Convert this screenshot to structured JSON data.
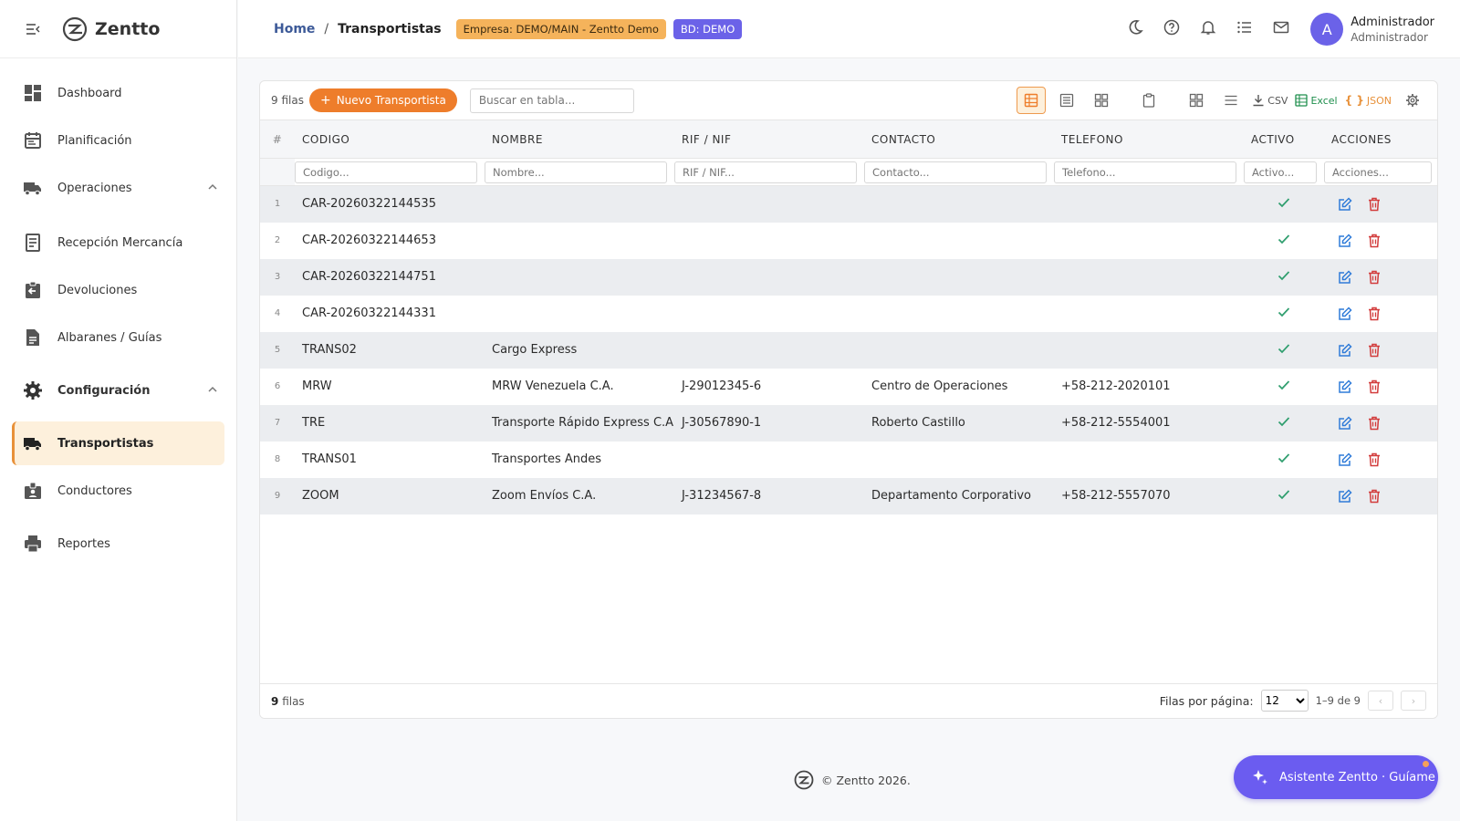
{
  "brand": {
    "name": "Zentto"
  },
  "sidebar": {
    "items": [
      {
        "label": "Dashboard"
      },
      {
        "label": "Planificación"
      },
      {
        "label": "Operaciones"
      },
      {
        "label": "Recepción Mercancía"
      },
      {
        "label": "Devoluciones"
      },
      {
        "label": "Albaranes / Guías"
      },
      {
        "label": "Configuración"
      },
      {
        "label": "Transportistas"
      },
      {
        "label": "Conductores"
      },
      {
        "label": "Reportes"
      }
    ]
  },
  "header": {
    "breadcrumb_home": "Home",
    "breadcrumb_sep": "/",
    "breadcrumb_current": "Transportistas",
    "badge_empresa": "Empresa: DEMO/MAIN - Zentto Demo",
    "badge_bd": "BD: DEMO",
    "user_initial": "A",
    "user_name": "Administrador",
    "user_role": "Administrador"
  },
  "toolbar": {
    "rows_count": "9 filas",
    "new_button": "Nuevo Transportista",
    "search_placeholder": "Buscar en tabla...",
    "csv_label": "CSV",
    "excel_label": "Excel",
    "json_label": "JSON"
  },
  "table": {
    "num_header": "#",
    "headers": [
      "CODIGO",
      "NOMBRE",
      "RIF / NIF",
      "CONTACTO",
      "TELEFONO",
      "ACTIVO",
      "ACCIONES"
    ],
    "filter_placeholders": [
      "Codigo...",
      "Nombre...",
      "RIF / NIF...",
      "Contacto...",
      "Telefono...",
      "Activo...",
      "Acciones..."
    ],
    "rows": [
      {
        "n": "1",
        "codigo": "CAR-20260322144535",
        "nombre": "",
        "rif": "",
        "contacto": "",
        "telefono": "",
        "activo": "✓"
      },
      {
        "n": "2",
        "codigo": "CAR-20260322144653",
        "nombre": "",
        "rif": "",
        "contacto": "",
        "telefono": "",
        "activo": "✓"
      },
      {
        "n": "3",
        "codigo": "CAR-20260322144751",
        "nombre": "",
        "rif": "",
        "contacto": "",
        "telefono": "",
        "activo": "✓"
      },
      {
        "n": "4",
        "codigo": "CAR-20260322144331",
        "nombre": "",
        "rif": "",
        "contacto": "",
        "telefono": "",
        "activo": "✓"
      },
      {
        "n": "5",
        "codigo": "TRANS02",
        "nombre": "Cargo Express",
        "rif": "",
        "contacto": "",
        "telefono": "",
        "activo": "✓"
      },
      {
        "n": "6",
        "codigo": "MRW",
        "nombre": "MRW Venezuela C.A.",
        "rif": "J-29012345-6",
        "contacto": "Centro de Operaciones",
        "telefono": "+58-212-2020101",
        "activo": "✓"
      },
      {
        "n": "7",
        "codigo": "TRE",
        "nombre": "Transporte Rápido Express C.A.",
        "rif": "J-30567890-1",
        "contacto": "Roberto Castillo",
        "telefono": "+58-212-5554001",
        "activo": "✓"
      },
      {
        "n": "8",
        "codigo": "TRANS01",
        "nombre": "Transportes Andes",
        "rif": "",
        "contacto": "",
        "telefono": "",
        "activo": "✓"
      },
      {
        "n": "9",
        "codigo": "ZOOM",
        "nombre": "Zoom Envíos C.A.",
        "rif": "J-31234567-8",
        "contacto": "Departamento Corporativo",
        "telefono": "+58-212-5557070",
        "activo": "✓"
      }
    ]
  },
  "footer": {
    "rows_bold": "9",
    "rows_text": "filas",
    "per_page_label": "Filas por página:",
    "per_page_value": "12",
    "range": "1–9 de 9",
    "prev": "‹",
    "next": "›"
  },
  "page_footer": {
    "copyright": "© Zentto 2026."
  },
  "assistant": {
    "label": "Asistente Zentto · Guíame"
  },
  "colors": {
    "accent": "#ee7d2b",
    "purple": "#6b62e8",
    "active_bg": "#fdf0dc",
    "check": "#2f9e6e",
    "delete": "#d23b3b",
    "edit": "#2f7bd8"
  }
}
